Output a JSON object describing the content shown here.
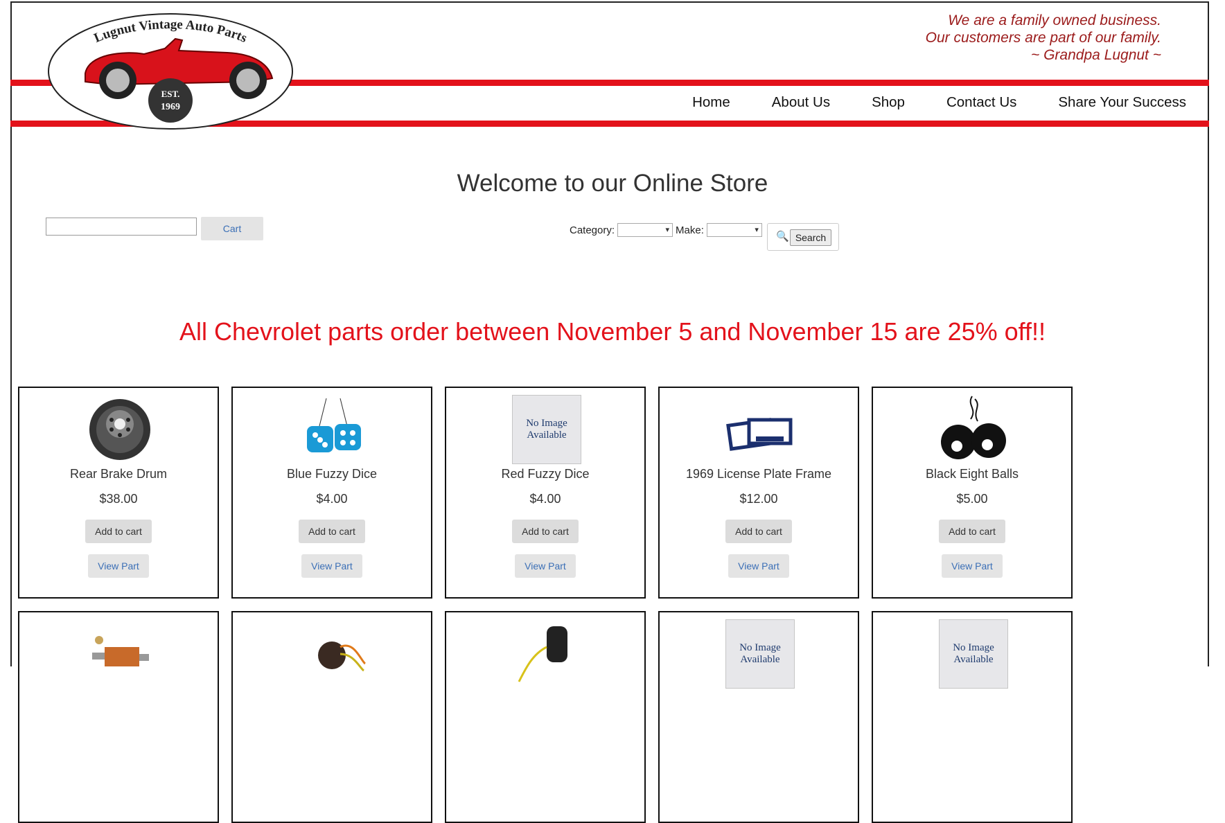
{
  "header": {
    "logo_text": "Lugnut Vintage Auto Parts",
    "logo_est": "EST.",
    "logo_year": "1969",
    "quote": [
      "We are a family owned business.",
      "Our customers are part of our family.",
      "~ Grandpa Lugnut ~"
    ],
    "nav": [
      "Home",
      "About Us",
      "Shop",
      "Contact Us",
      "Share Your Success"
    ]
  },
  "store": {
    "title": "Welcome to our Online Store",
    "cart_label": "Cart",
    "category_label": "Category:",
    "make_label": "Make:",
    "search_label": "Search",
    "promo": "All Chevrolet parts order between November 5 and November 15 are 25% off!!"
  },
  "buttons": {
    "add_to_cart": "Add to cart",
    "view_part": "View Part"
  },
  "no_image_text": "No Image Available",
  "products_row1": [
    {
      "name": "Rear Brake Drum",
      "price": "$38.00",
      "icon": "brake-drum-image"
    },
    {
      "name": "Blue Fuzzy Dice",
      "price": "$4.00",
      "icon": "fuzzy-dice-image"
    },
    {
      "name": "Red Fuzzy Dice",
      "price": "$4.00",
      "icon": "no-image"
    },
    {
      "name": "1969 License Plate Frame",
      "price": "$12.00",
      "icon": "license-plate-frame-image"
    },
    {
      "name": "Black Eight Balls",
      "price": "$5.00",
      "icon": "eight-balls-image"
    }
  ],
  "products_row2_icons": [
    "switch-image",
    "wiring-harness-image",
    "motor-image",
    "no-image",
    "no-image"
  ],
  "colors": {
    "accent_red": "#e3121b",
    "quote_red": "#9b1b1b",
    "link_blue": "#3b6fb6"
  }
}
